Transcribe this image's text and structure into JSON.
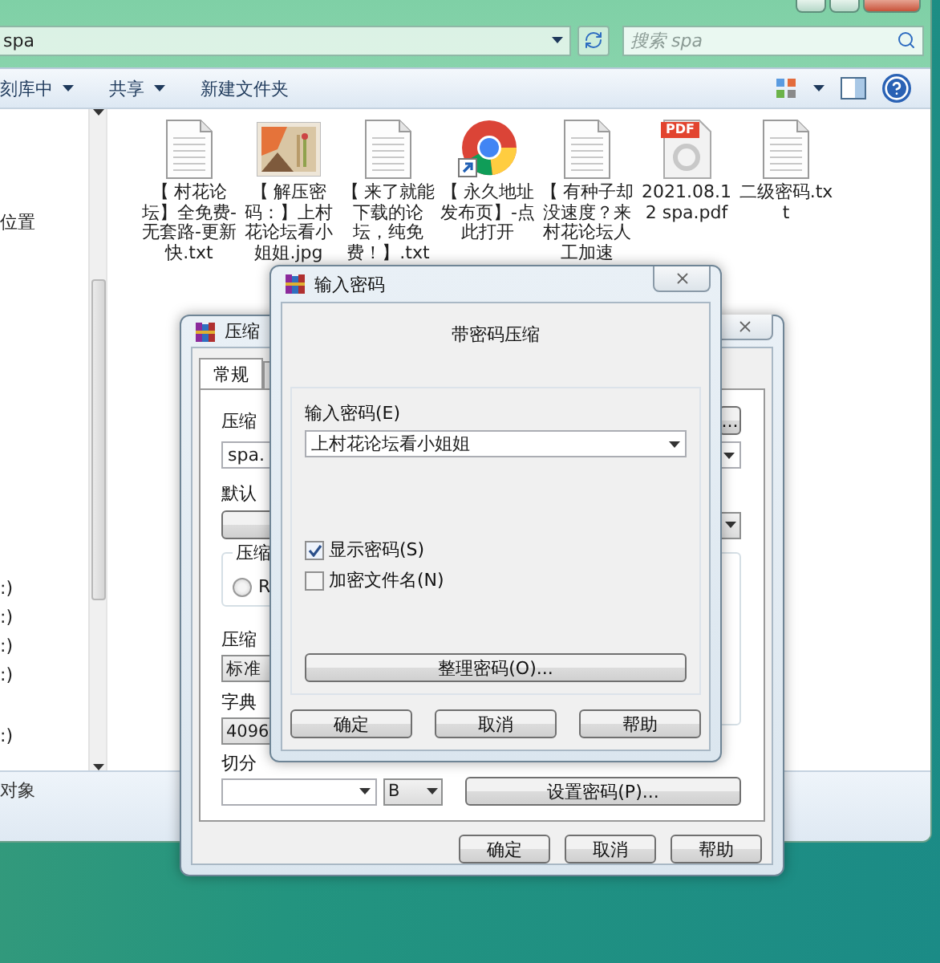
{
  "explorer": {
    "address": "spa",
    "search": {
      "placeholder": "搜索 spa"
    },
    "toolbar": [
      {
        "label": "刻库中",
        "caret": true
      },
      {
        "label": "共享",
        "caret": true
      },
      {
        "label": "新建文件夹",
        "caret": false
      }
    ],
    "nav_sections": [
      [
        "位置"
      ],
      [
        ":)",
        ":)",
        ":)",
        ":)"
      ],
      [
        ":)"
      ]
    ],
    "files": [
      {
        "kind": "text",
        "name": "【 村花论坛】全免费-无套路-更新快.txt"
      },
      {
        "name": "【 解压密码：】上村花论坛看小姐姐.jpg"
      },
      {
        "kind": "text",
        "name": "【 来了就能下载的论坛，纯免费！】.txt"
      },
      {
        "kind": "browser",
        "name": "【 永久地址发布页】-点此打开"
      },
      {
        "kind": "text",
        "name": "【 有种子却没速度？来村花论坛人工加速"
      },
      {
        "kind": "pdf",
        "badge": "PDF",
        "name": "2021.08.12 spa.pdf"
      },
      {
        "kind": "text",
        "name": "二级密码.txt"
      }
    ],
    "status": "对象"
  },
  "archive_dialog": {
    "title": "压缩",
    "tabs": [
      {
        "label": "常规",
        "selected": true
      }
    ],
    "archive_name_label": "压缩",
    "browse": "...",
    "archive_name": "spa.",
    "profile_label": "默认",
    "format_group": "压缩",
    "format_radio": {
      "label": "R",
      "selected": false
    },
    "method_label": "压缩",
    "method": "标准",
    "dict_label": "字典",
    "dict": "4096",
    "split_label": "切分",
    "split_unit": "B",
    "set_password": "设置密码(P)...",
    "buttons": [
      "确定",
      "取消",
      "帮助"
    ]
  },
  "password_dialog": {
    "title": "输入密码",
    "heading": "带密码压缩",
    "password_label": "输入密码(E)",
    "password": "上村花论坛看小姐姐",
    "options": [
      {
        "label": "显示密码(S)",
        "checked": true
      },
      {
        "label": "加密文件名(N)",
        "checked": false
      }
    ],
    "organize": "整理密码(O)...",
    "buttons": [
      "确定",
      "取消",
      "帮助"
    ]
  }
}
